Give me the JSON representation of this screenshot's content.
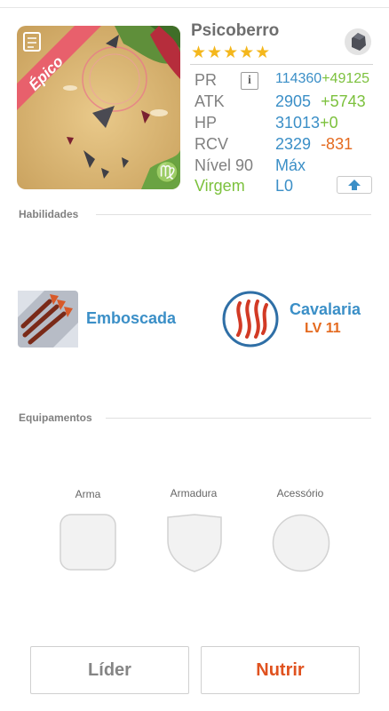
{
  "character": {
    "name": "Psicoberro",
    "rarity_badge": "Épico",
    "stars": "★★★★★",
    "star_count": 5,
    "stats": {
      "pr": {
        "label": "PR",
        "value": "114360",
        "delta": "+49125"
      },
      "atk": {
        "label": "ATK",
        "value": "2905",
        "delta": "+5743"
      },
      "hp": {
        "label": "HP",
        "value": "31013",
        "delta": "+0"
      },
      "rcv": {
        "label": "RCV",
        "value": "2329",
        "delta": "-831"
      },
      "level": {
        "label": "Nível 90",
        "value": "Máx"
      },
      "sign": {
        "label": "Virgem",
        "value": "L0"
      }
    },
    "info_button": "i"
  },
  "sections": {
    "skills_title": "Habilidades",
    "equipment_title": "Equipamentos"
  },
  "skills": [
    {
      "name": "Emboscada",
      "icon": "arrows-icon"
    },
    {
      "name": "Cavalaria",
      "level": "LV 11",
      "icon": "claw-marks-icon"
    }
  ],
  "equipment": [
    {
      "label": "Arma",
      "shape": "rounded-square"
    },
    {
      "label": "Armadura",
      "shape": "shield"
    },
    {
      "label": "Acessório",
      "shape": "circle"
    }
  ],
  "buttons": {
    "leader": "Líder",
    "feed": "Nutrir"
  },
  "colors": {
    "accent_blue": "#3b8fc7",
    "positive_green": "#7cc13d",
    "negative_orange": "#e46a1f",
    "star_gold": "#f4b71c",
    "epic_ribbon": "#e8606c"
  }
}
